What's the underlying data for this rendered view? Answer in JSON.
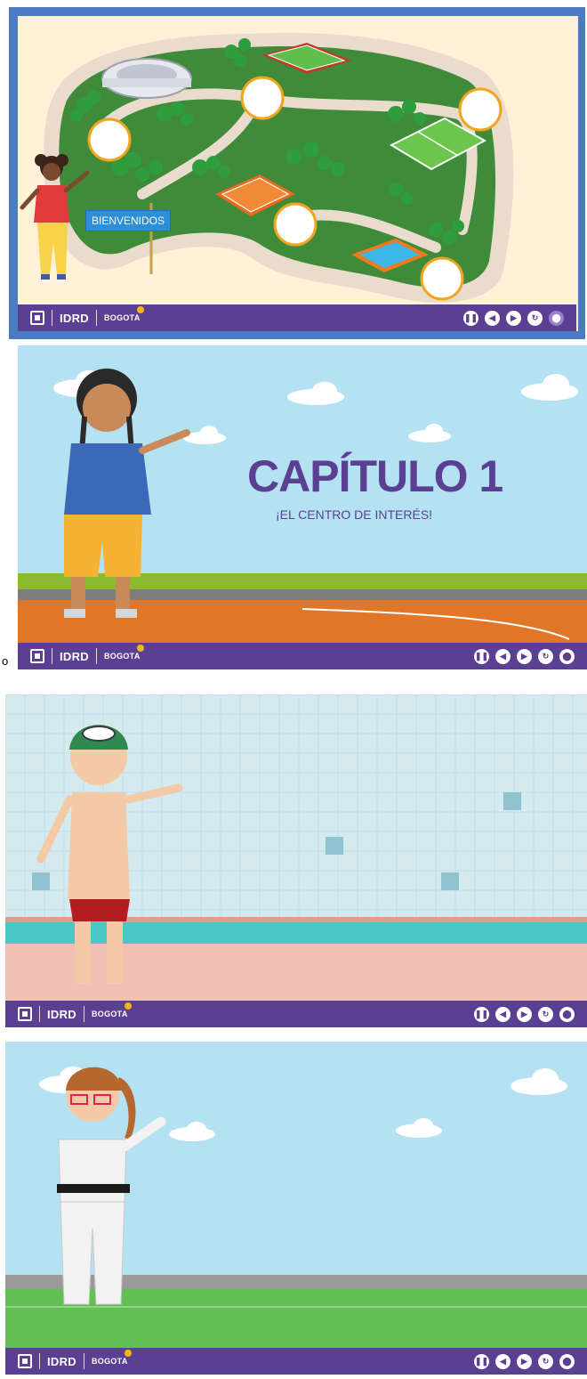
{
  "slides": [
    {
      "id": "map",
      "banner": "BIENVENIDOS"
    },
    {
      "id": "chapter",
      "title": "CAPÍTULO 1",
      "subtitle": "¡EL CENTRO DE INTERÉS!"
    },
    {
      "id": "pool"
    },
    {
      "id": "karate"
    }
  ],
  "footer": {
    "brand_idrd": "IDRD",
    "brand_bogota": "BOGOTA",
    "controls": [
      {
        "name": "pause",
        "glyph": "❚❚"
      },
      {
        "name": "previous",
        "glyph": "◀"
      },
      {
        "name": "next",
        "glyph": "▶"
      },
      {
        "name": "reload",
        "glyph": "↻"
      },
      {
        "name": "map",
        "glyph": "⬤"
      }
    ]
  },
  "stray_char": "o",
  "colors": {
    "purple": "#5b3f93",
    "sky": "#b4e2f2",
    "grass": "#3f8b3a"
  }
}
